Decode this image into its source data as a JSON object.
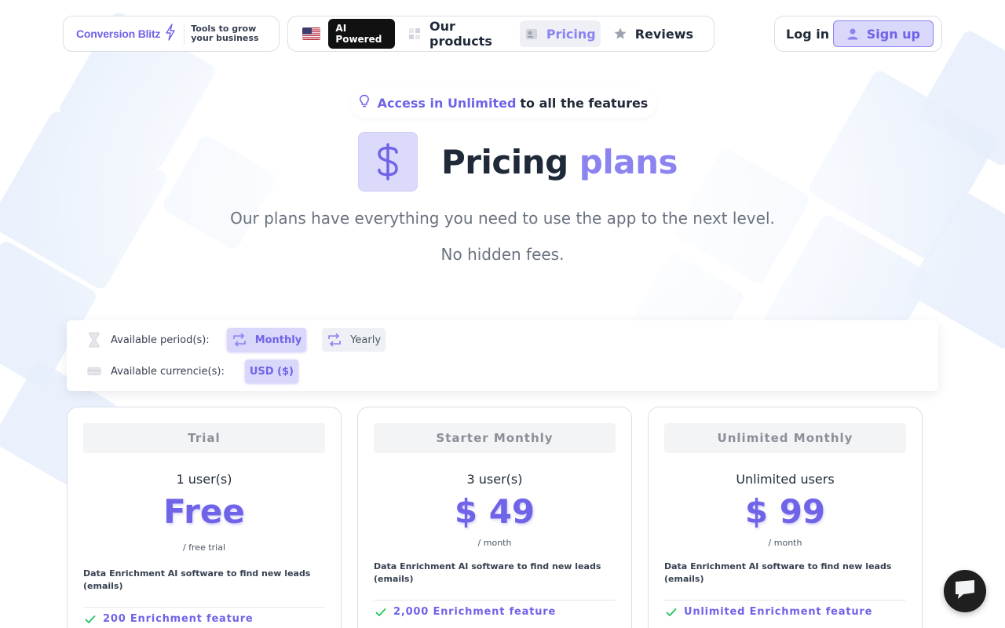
{
  "brand": {
    "name": "Conversion Blitz",
    "tagline": "Tools to grow your business"
  },
  "nav": {
    "badge": "AI Powered",
    "items": [
      {
        "label": "Our products",
        "icon": "products-icon"
      },
      {
        "label": "Pricing",
        "icon": "pricing-icon",
        "active": true
      },
      {
        "label": "Reviews",
        "icon": "star-icon"
      }
    ]
  },
  "auth": {
    "login": "Log in",
    "signup": "Sign up"
  },
  "hero": {
    "announce_highlight": "Access in Unlimited",
    "announce_rest": "to all the features",
    "title_main": "Pricing",
    "title_accent": "plans",
    "subtitle": "Our plans have everything you need to use the app to the next level.",
    "subtitle2": "No hidden fees."
  },
  "filters": {
    "period_label": "Available period(s):",
    "periods": [
      "Monthly",
      "Yearly"
    ],
    "selected_period": "Monthly",
    "currency_label": "Available currencie(s):",
    "currencies": [
      "USD ($)"
    ]
  },
  "plans": [
    {
      "name": "Trial",
      "users": "1 user(s)",
      "price": "Free",
      "per": "/ free trial",
      "description": "Data Enrichment AI software to find new leads (emails)",
      "features": [
        "200 Enrichment feature"
      ]
    },
    {
      "name": "Starter Monthly",
      "users": "3 user(s)",
      "price": "$ 49",
      "per": "/ month",
      "description": "Data Enrichment AI software to find new leads (emails)",
      "features": [
        "2,000 Enrichment feature"
      ]
    },
    {
      "name": "Unlimited Monthly",
      "users": "Unlimited users",
      "price": "$ 99",
      "per": "/ month",
      "description": "Data Enrichment AI software to find new leads (emails)",
      "features": [
        "Unlimited Enrichment feature"
      ]
    }
  ],
  "colors": {
    "accent": "#6f63e8",
    "accent_light": "#d9d7fa",
    "text": "#1f2937",
    "muted": "#6b7280"
  }
}
